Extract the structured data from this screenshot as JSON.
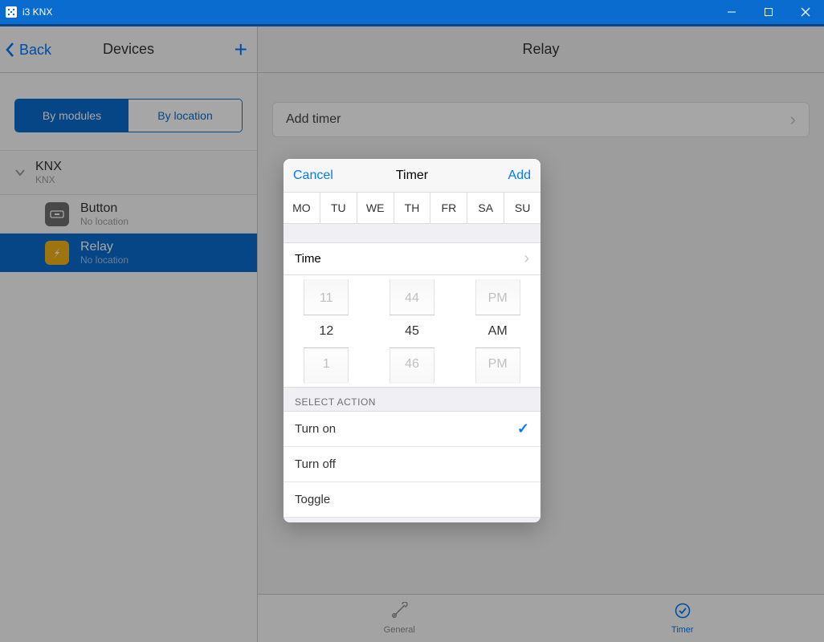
{
  "window": {
    "title": "i3 KNX"
  },
  "sidebar": {
    "back": "Back",
    "title": "Devices",
    "segment": {
      "by_modules": "By modules",
      "by_location": "By location"
    },
    "group": {
      "title": "KNX",
      "subtitle": "KNX"
    },
    "devices": [
      {
        "title": "Button",
        "subtitle": "No location"
      },
      {
        "title": "Relay",
        "subtitle": "No location"
      }
    ]
  },
  "main": {
    "title": "Relay",
    "add_timer": "Add timer",
    "tabs": {
      "general": "General",
      "timer": "Timer"
    }
  },
  "modal": {
    "cancel": "Cancel",
    "title": "Timer",
    "add": "Add",
    "days": [
      "MO",
      "TU",
      "WE",
      "TH",
      "FR",
      "SA",
      "SU"
    ],
    "time_label": "Time",
    "picker": {
      "hour": {
        "prev": "11",
        "cur": "12",
        "next": "1"
      },
      "minute": {
        "prev": "44",
        "cur": "45",
        "next": "46"
      },
      "ampm": {
        "prev": "PM",
        "cur": "AM",
        "next": "PM"
      }
    },
    "section_action": "SELECT ACTION",
    "actions": {
      "turn_on": "Turn on",
      "turn_off": "Turn off",
      "toggle": "Toggle"
    }
  }
}
